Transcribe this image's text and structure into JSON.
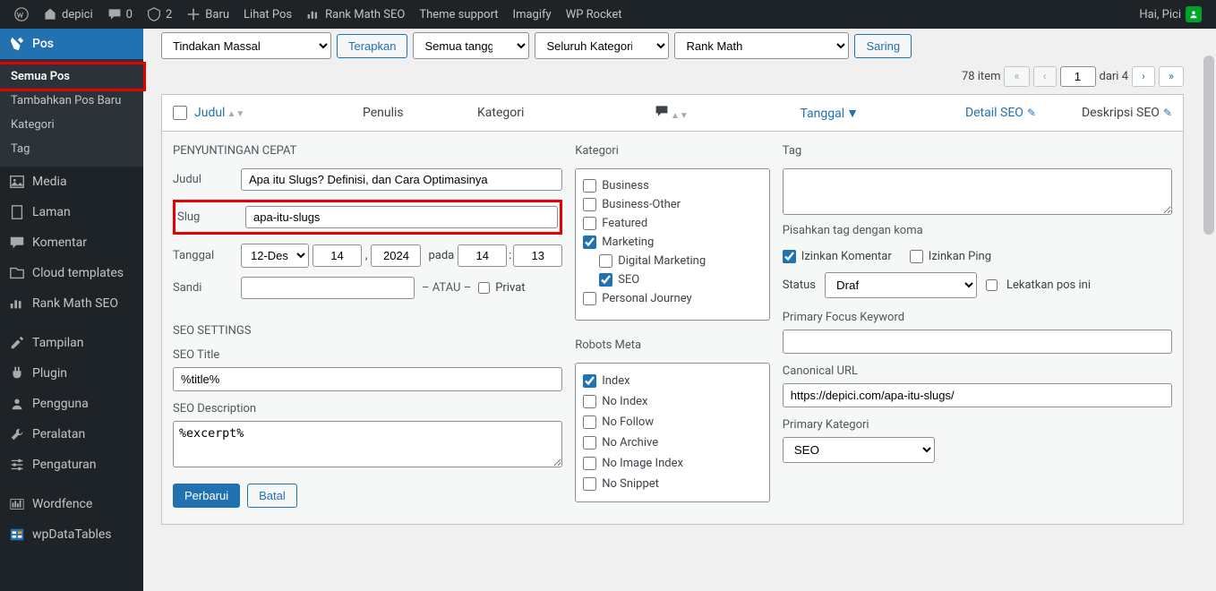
{
  "adminbar": {
    "site_name": "depici",
    "comments_count": "0",
    "updates_count": "2",
    "new_label": "Baru",
    "view_posts": "Lihat Pos",
    "rank_math": "Rank Math SEO",
    "theme_support": "Theme support",
    "imagify": "Imagify",
    "wp_rocket": "WP Rocket",
    "howdy": "Hai, Pici"
  },
  "sidebar": {
    "pos": "Pos",
    "sub": {
      "all_posts": "Semua Pos",
      "add_new": "Tambahkan Pos Baru",
      "categories": "Kategori",
      "tags": "Tag"
    },
    "media": "Media",
    "pages": "Laman",
    "comments": "Komentar",
    "cloud_templates": "Cloud templates",
    "rank_math": "Rank Math SEO",
    "appearance": "Tampilan",
    "plugins": "Plugin",
    "users": "Pengguna",
    "tools": "Peralatan",
    "settings": "Pengaturan",
    "wordfence": "Wordfence",
    "wpdatatables": "wpDataTables"
  },
  "filters": {
    "bulk_actions": "Tindakan Massal",
    "apply": "Terapkan",
    "all_dates": "Semua tanggal",
    "all_categories": "Seluruh Kategori",
    "rank_math": "Rank Math",
    "filter": "Saring"
  },
  "pagination": {
    "items": "78 item",
    "current": "1",
    "total": "dari 4"
  },
  "table": {
    "title": "Judul",
    "author": "Penulis",
    "category": "Kategori",
    "date": "Tanggal",
    "detail_seo": "Detail SEO",
    "desc_seo": "Deskripsi SEO"
  },
  "quick_edit": {
    "heading": "PENYUNTINGAN CEPAT",
    "title_label": "Judul",
    "title_value": "Apa itu Slugs? Definisi, dan Cara Optimasinya",
    "slug_label": "Slug",
    "slug_value": "apa-itu-slugs",
    "date_label": "Tanggal",
    "month": "12-Des",
    "day": "14",
    "year": "2024",
    "at": "pada",
    "hour": "14",
    "minute": "13",
    "password_label": "Sandi",
    "or": "– ATAU –",
    "private": "Privat",
    "seo_settings_heading": "SEO SETTINGS",
    "seo_title_label": "SEO Title",
    "seo_title_value": "%title%",
    "seo_desc_label": "SEO Description",
    "seo_desc_value": "%excerpt%",
    "categories_label": "Kategori",
    "categories": {
      "business": "Business",
      "business_other": "Business-Other",
      "featured": "Featured",
      "marketing": "Marketing",
      "digital_marketing": "Digital Marketing",
      "seo": "SEO",
      "personal_journey": "Personal Journey"
    },
    "robots_meta_label": "Robots Meta",
    "robots": {
      "index": "Index",
      "no_index": "No Index",
      "no_follow": "No Follow",
      "no_archive": "No Archive",
      "no_image_index": "No Image Index",
      "no_snippet": "No Snippet"
    },
    "tag_label": "Tag",
    "tag_hint": "Pisahkan tag dengan koma",
    "allow_comments": "Izinkan Komentar",
    "allow_pings": "Izinkan Ping",
    "status_label": "Status",
    "status_value": "Draf",
    "sticky": "Lekatkan pos ini",
    "focus_keyword_label": "Primary Focus Keyword",
    "canonical_label": "Canonical URL",
    "canonical_value": "https://depici.com/apa-itu-slugs/",
    "primary_category_label": "Primary Kategori",
    "primary_category_value": "SEO",
    "update": "Perbarui",
    "cancel": "Batal"
  }
}
